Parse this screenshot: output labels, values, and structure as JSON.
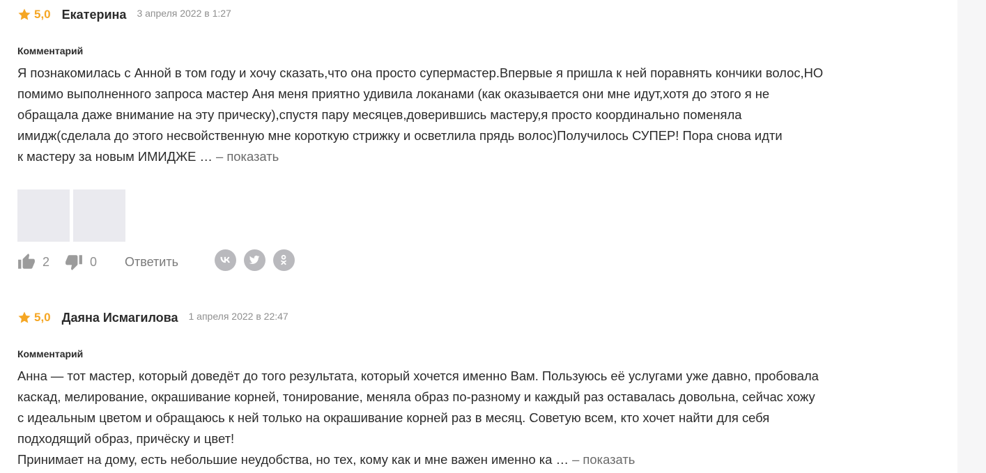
{
  "reviews": [
    {
      "rating": "5,0",
      "author": "Екатерина",
      "date": "3 апреля 2022 в 1:27",
      "section_label": "Комментарий",
      "lines": [
        "Я познакомилась с Анной в том году и хочу сказать,что она просто супермастер.Впервые я пришла к ней поравнять кончики волос,НО",
        "помимо выполненного запроса мастер Аня меня приятно удивила локанами (как оказывается они мне идут,хотя до этого я не",
        "обращала даже внимание на эту прическу),спустя пару месяцев,доверившись мастеру,я просто координально поменяла",
        "имидж(сделала до этого несвойственную мне короткую стрижку и осветлила прядь волос)Получилось СУПЕР! Пора снова идти",
        "к мастеру за новым ИМИДЖЕ …"
      ],
      "show_more": "– показать",
      "likes": "2",
      "dislikes": "0",
      "reply_label": "Ответить"
    },
    {
      "rating": "5,0",
      "author": "Даяна Исмагилова",
      "date": "1 апреля 2022 в 22:47",
      "section_label": "Комментарий",
      "lines": [
        "Анна — тот мастер, который доведёт до того результата, который хочется именно Вам. Пользуюсь её услугами уже давно, пробовала",
        "каскад, мелирование, окрашивание корней, тонирование, меняла образ по-разному и каждый раз оставалась довольна, сейчас хожу",
        "с идеальным цветом и обращаюсь к ней только на окрашивание корней раз в месяц. Советую всем, кто хочет найти для себя",
        "подходящий образ, причёску и цвет!",
        "Принимает на дому, есть небольшие неудобства, но тех, кому как и мне важен именно ка …"
      ],
      "show_more": "– показать"
    }
  ],
  "colors": {
    "accent": "#f5a623",
    "text": "#2b2b2b",
    "muted": "#8f8f8f",
    "photo_placeholder": "#eaeaef",
    "social_icon_bg": "#b9b9bd"
  },
  "icons": [
    "star-icon",
    "thumbs-up-icon",
    "thumbs-down-icon",
    "vk-icon",
    "twitter-icon",
    "odnoklassniki-icon"
  ]
}
